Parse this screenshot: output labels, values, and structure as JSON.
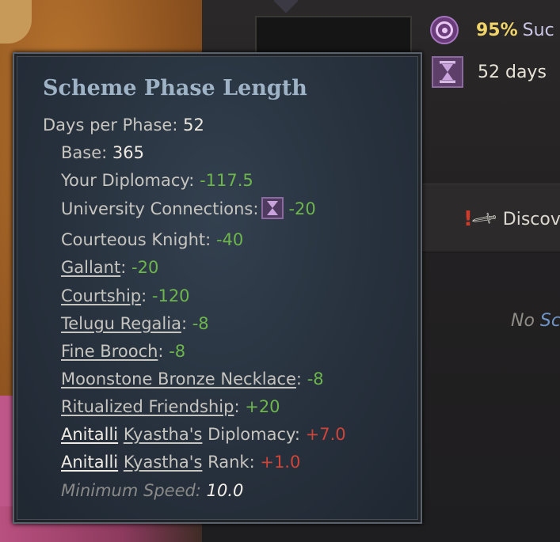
{
  "panel": {
    "success_pct": "95%",
    "success_label": "Suc",
    "days_label": "52 days",
    "discover_label": "Discov",
    "no_schemes_a": "No",
    "no_schemes_b": "Sc"
  },
  "tooltip": {
    "title": "Scheme Phase Length",
    "days_per_phase_label": "Days per Phase:",
    "days_per_phase_value": "52",
    "base_label": "Base:",
    "base_value": "365",
    "your_diplomacy_label": "Your Diplomacy:",
    "your_diplomacy_value": "-117.5",
    "university_label": "University Connections:",
    "university_value": "-20",
    "courteous_label": "Courteous Knight:",
    "courteous_value": "-40",
    "gallant_label": "Gallant",
    "gallant_value": "-20",
    "courtship_label": "Courtship",
    "courtship_value": "-120",
    "telugu_label": "Telugu Regalia",
    "telugu_value": "-8",
    "brooch_label": "Fine Brooch",
    "brooch_value": "-8",
    "necklace_label": "Moonstone Bronze Necklace",
    "necklace_value": "-8",
    "ritual_label": "Ritualized Friendship",
    "ritual_value": "+20",
    "target_first": "Anitalli",
    "target_last": "Kyastha's",
    "target_diplomacy_label": "Diplomacy:",
    "target_diplomacy_value": "+7.0",
    "target_rank_label": "Rank:",
    "target_rank_value": "+1.0",
    "min_speed_label": "Minimum Speed:",
    "min_speed_value": "10.0",
    "colon": ":"
  },
  "colors": {
    "negative_good": "#6db64c",
    "positive_bad": "#d0443a",
    "title": "#9fb3c6",
    "success_pct": "#f0d46a"
  },
  "icons": [
    "target-icon",
    "hourglass-icon",
    "dagger-icon"
  ]
}
